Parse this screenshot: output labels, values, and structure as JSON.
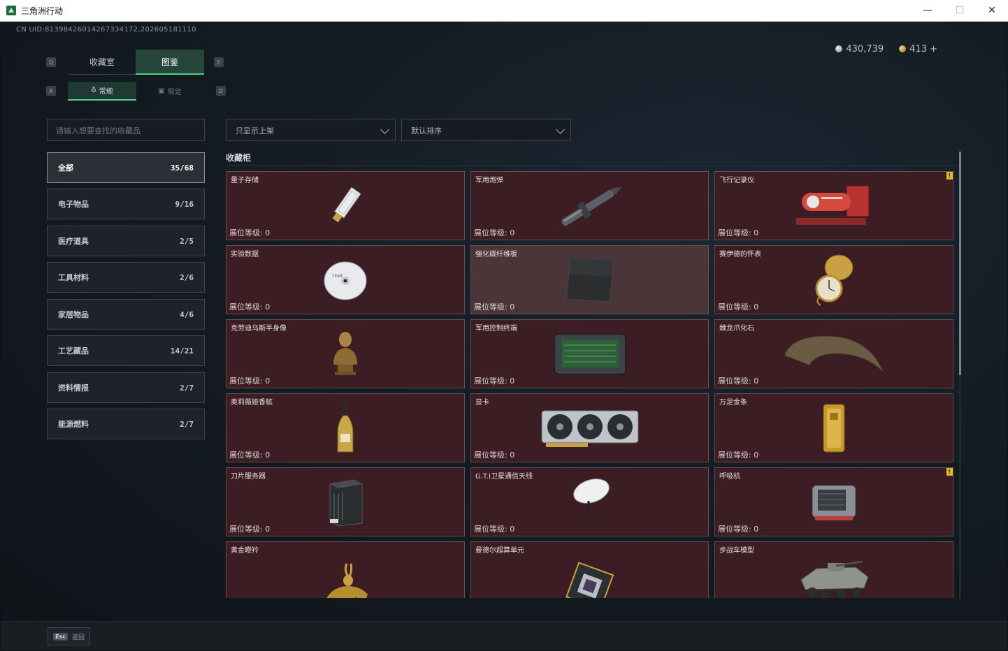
{
  "window": {
    "title": "三角洲行动",
    "min": "—",
    "max": "☐",
    "close": "✕"
  },
  "uid": "CN UID:81398426014267334172,202605181110",
  "currency": {
    "silver": "430,739",
    "gold": "413 +"
  },
  "key_hints": {
    "q": "Q",
    "e": "E",
    "a": "A",
    "d": "D"
  },
  "tabs": [
    {
      "label": "收藏室"
    },
    {
      "label": "图鉴"
    }
  ],
  "subtabs": [
    {
      "label": "常规"
    },
    {
      "label": "限定"
    }
  ],
  "search": {
    "placeholder": "请输入想要查找的收藏品"
  },
  "filters": {
    "shelf": "只显示上架",
    "sort": "默认排序"
  },
  "categories": [
    {
      "label": "全部",
      "count": "35/68"
    },
    {
      "label": "电子物品",
      "count": "9/16"
    },
    {
      "label": "医疗道具",
      "count": "2/5"
    },
    {
      "label": "工具材料",
      "count": "2/6"
    },
    {
      "label": "家居物品",
      "count": "4/6"
    },
    {
      "label": "工艺藏品",
      "count": "14/21"
    },
    {
      "label": "资料情报",
      "count": "2/7"
    },
    {
      "label": "能源燃料",
      "count": "2/7"
    }
  ],
  "section_title": "收藏柜",
  "level_label": "展位等级: 0",
  "items": [
    {
      "name": "量子存储",
      "icon": "usb-drive-icon"
    },
    {
      "name": "军用炮弹",
      "icon": "artillery-shell-icon"
    },
    {
      "name": "飞行记录仪",
      "icon": "flight-recorder-icon",
      "badge": "!"
    },
    {
      "name": "实验数据",
      "icon": "disc-icon"
    },
    {
      "name": "强化碳纤维板",
      "icon": "carbon-plate-icon"
    },
    {
      "name": "赛伊德的怀表",
      "icon": "pocket-watch-icon"
    },
    {
      "name": "克劳迪乌斯半身像",
      "icon": "bust-icon"
    },
    {
      "name": "军用控制终端",
      "icon": "terminal-icon"
    },
    {
      "name": "棘龙爪化石",
      "icon": "claw-fossil-icon"
    },
    {
      "name": "奥莉薇娅香槟",
      "icon": "champagne-icon"
    },
    {
      "name": "显卡",
      "icon": "gpu-icon"
    },
    {
      "name": "万足金条",
      "icon": "gold-bar-icon"
    },
    {
      "name": "刀片服务器",
      "icon": "server-icon"
    },
    {
      "name": "G.T.I卫星通信天线",
      "icon": "satellite-dish-icon"
    },
    {
      "name": "呼吸机",
      "icon": "ventilator-icon",
      "badge": "!"
    },
    {
      "name": "黄金瞪羚",
      "icon": "gazelle-icon"
    },
    {
      "name": "曼德尔超算单元",
      "icon": "chip-icon"
    },
    {
      "name": "步战车模型",
      "icon": "ifv-model-icon"
    }
  ],
  "footer": {
    "esc": "Esc",
    "back": "返回"
  }
}
